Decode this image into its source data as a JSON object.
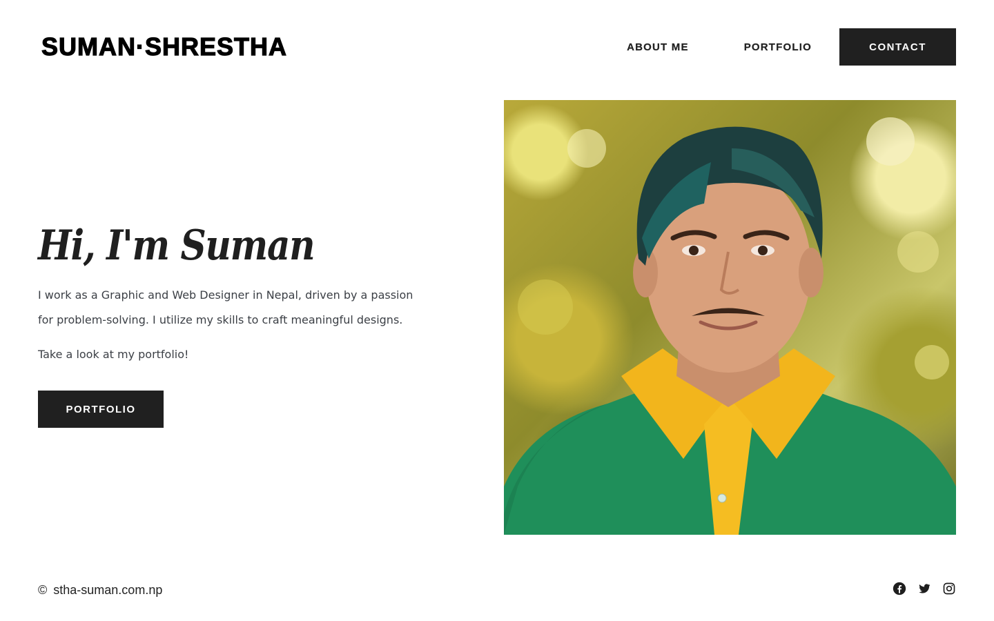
{
  "header": {
    "logo": "SUMAN·SHRESTHA",
    "nav": {
      "about": "ABOUT ME",
      "portfolio": "PORTFOLIO",
      "contact": "CONTACT"
    }
  },
  "hero": {
    "title": "Hi, I'm Suman",
    "description": "I work as a Graphic and Web Designer in Nepal, driven by a passion for problem-solving. I utilize my skills to craft meaningful designs.",
    "cta_text": "Take a look at my portfolio!",
    "button_label": "PORTFOLIO",
    "photo_icon": "portrait-photo"
  },
  "footer": {
    "copyright_symbol": "©",
    "site": "stha-suman.com.np",
    "social": [
      "facebook-icon",
      "twitter-icon",
      "instagram-icon"
    ]
  },
  "colors": {
    "primary_dark": "#202020",
    "text": "#3b3f45",
    "shirt_green": "#1f8f5a",
    "collar_yellow": "#f2b51c"
  }
}
